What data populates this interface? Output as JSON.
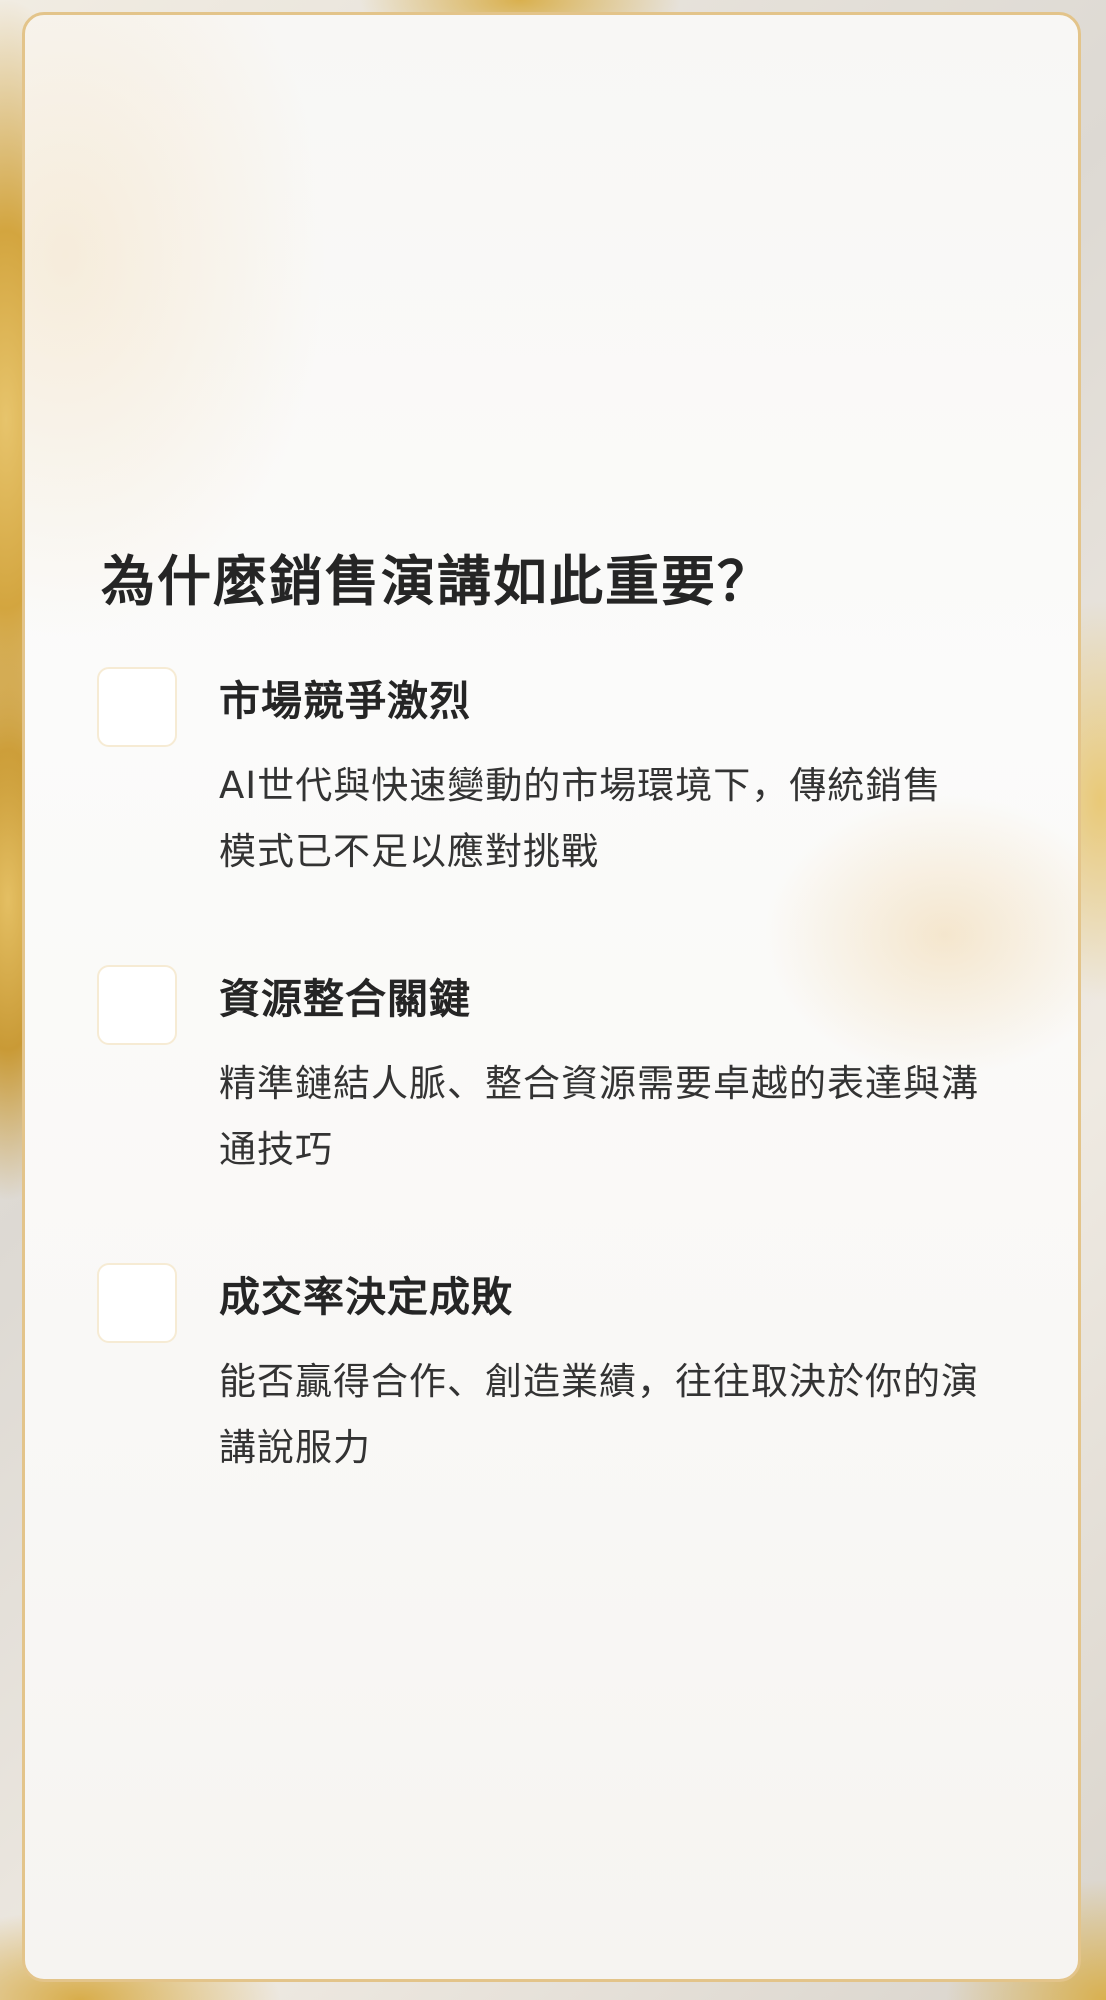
{
  "title": "為什麼銷售演講如此重要？",
  "features": [
    {
      "heading": "市場競爭激烈",
      "description": "AI世代與快速變動的市場環境下，傳統銷售模式已不足以應對挑戰"
    },
    {
      "heading": "資源整合關鍵",
      "description": "精準鏈結人脈、整合資源需要卓越的表達與溝通技巧"
    },
    {
      "heading": "成交率決定成敗",
      "description": "能否贏得合作、創造業績，往往取決於你的演講說服力"
    }
  ]
}
